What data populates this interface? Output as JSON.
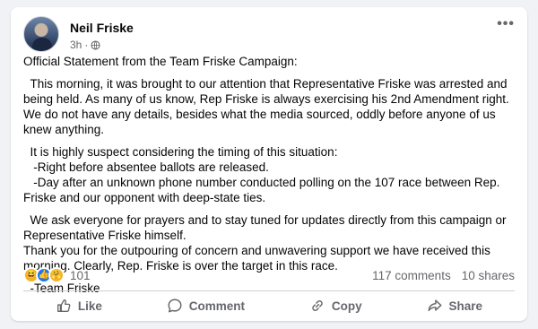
{
  "post": {
    "author": "Neil Friske",
    "time": "3h",
    "separator": "·",
    "paragraphs": [
      "Official Statement from the Team Friske Campaign:",
      "  This morning, it was brought to our attention that Representative Friske was arrested and being held. As many of us know, Rep Friske is always exercising his 2nd Amendment right. We do not have any details, besides what the media sourced, oddly before anyone of us knew anything.",
      "  It is highly suspect considering the timing of this situation:\n   -Right before absentee ballots are released.\n   -Day after an unknown phone number conducted polling on the 107 race between Rep. Friske and our opponent with deep-state ties.",
      "  We ask everyone for prayers and to stay tuned for updates directly from this campaign or Representative Friske himself.\nThank you for the outpouring of concern and unwavering support we have received this morning. Clearly, Rep. Friske is over the target in this race.",
      "  -Team Friske"
    ]
  },
  "stats": {
    "reaction_count": "101",
    "comments": "117 comments",
    "shares": "10 shares"
  },
  "actions": {
    "like": "Like",
    "comment": "Comment",
    "copy": "Copy",
    "share": "Share"
  },
  "icons": {
    "reactions": [
      "haha-icon",
      "like-icon",
      "care-icon"
    ],
    "privacy": "globe-icon",
    "menu": "more-options-icon"
  },
  "colors": {
    "like_blue": "#1877f2",
    "secondary_text": "#65676b",
    "reaction_yellow": "#f7b125"
  }
}
